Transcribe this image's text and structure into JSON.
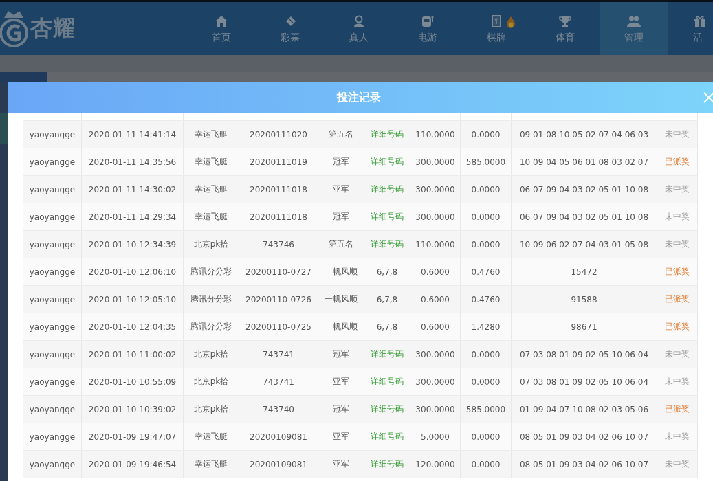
{
  "header": {
    "logo": "杏耀",
    "nav": [
      {
        "label": "首页",
        "kind": "home",
        "selected": false,
        "badge": false
      },
      {
        "label": "彩票",
        "kind": "ticket",
        "selected": false,
        "badge": false
      },
      {
        "label": "真人",
        "kind": "person",
        "selected": false,
        "badge": false
      },
      {
        "label": "电游",
        "kind": "slot",
        "selected": false,
        "badge": false
      },
      {
        "label": "棋牌",
        "kind": "tile",
        "selected": false,
        "badge": true
      },
      {
        "label": "体育",
        "kind": "trophy",
        "selected": false,
        "badge": false
      },
      {
        "label": "管理",
        "kind": "people",
        "selected": true,
        "badge": false
      },
      {
        "label": "活",
        "kind": "gift",
        "selected": false,
        "badge": false
      }
    ]
  },
  "modal": {
    "title": "投注记录",
    "rows": [
      {
        "user": "yaoyangge",
        "time": "2020-01-11 14:41:14",
        "game": "幸运飞艇",
        "issue": "20200111020",
        "play": "第五名",
        "detail": {
          "text": "详细号码",
          "kind": "link"
        },
        "bet": "110.0000",
        "win": "0.0000",
        "numbers": "09 01 08 10 05 02 07 04 06 03",
        "status": {
          "text": "未中奖",
          "kind": "lost"
        }
      },
      {
        "user": "yaoyangge",
        "time": "2020-01-11 14:35:56",
        "game": "幸运飞艇",
        "issue": "20200111019",
        "play": "冠军",
        "detail": {
          "text": "详细号码",
          "kind": "link"
        },
        "bet": "300.0000",
        "win": "585.0000",
        "numbers": "10 09 04 05 06 01 08 03 02 07",
        "status": {
          "text": "已派奖",
          "kind": "paid"
        }
      },
      {
        "user": "yaoyangge",
        "time": "2020-01-11 14:30:02",
        "game": "幸运飞艇",
        "issue": "20200111018",
        "play": "亚军",
        "detail": {
          "text": "详细号码",
          "kind": "link"
        },
        "bet": "300.0000",
        "win": "0.0000",
        "numbers": "06 07 09 04 03 02 05 01 10 08",
        "status": {
          "text": "未中奖",
          "kind": "lost"
        }
      },
      {
        "user": "yaoyangge",
        "time": "2020-01-11 14:29:34",
        "game": "幸运飞艇",
        "issue": "20200111018",
        "play": "冠军",
        "detail": {
          "text": "详细号码",
          "kind": "link"
        },
        "bet": "300.0000",
        "win": "0.0000",
        "numbers": "06 07 09 04 03 02 05 01 10 08",
        "status": {
          "text": "未中奖",
          "kind": "lost"
        }
      },
      {
        "user": "yaoyangge",
        "time": "2020-01-10 12:34:39",
        "game": "北京pk拾",
        "issue": "743746",
        "play": "第五名",
        "detail": {
          "text": "详细号码",
          "kind": "link"
        },
        "bet": "110.0000",
        "win": "0.0000",
        "numbers": "10 09 06 02 07 04 03 01 05 08",
        "status": {
          "text": "未中奖",
          "kind": "lost"
        }
      },
      {
        "user": "yaoyangge",
        "time": "2020-01-10 12:06:10",
        "game": "腾讯分分彩",
        "issue": "20200110-0727",
        "play": "一帆风顺",
        "detail": {
          "text": "6,7,8",
          "kind": "plain"
        },
        "bet": "0.6000",
        "win": "0.4760",
        "numbers": "15472",
        "status": {
          "text": "已派奖",
          "kind": "paid"
        }
      },
      {
        "user": "yaoyangge",
        "time": "2020-01-10 12:05:10",
        "game": "腾讯分分彩",
        "issue": "20200110-0726",
        "play": "一帆风顺",
        "detail": {
          "text": "6,7,8",
          "kind": "plain"
        },
        "bet": "0.6000",
        "win": "0.4760",
        "numbers": "91588",
        "status": {
          "text": "已派奖",
          "kind": "paid"
        }
      },
      {
        "user": "yaoyangge",
        "time": "2020-01-10 12:04:35",
        "game": "腾讯分分彩",
        "issue": "20200110-0725",
        "play": "一帆风顺",
        "detail": {
          "text": "6,7,8",
          "kind": "plain"
        },
        "bet": "0.6000",
        "win": "1.4280",
        "numbers": "98671",
        "status": {
          "text": "已派奖",
          "kind": "paid"
        }
      },
      {
        "user": "yaoyangge",
        "time": "2020-01-10 11:00:02",
        "game": "北京pk拾",
        "issue": "743741",
        "play": "冠军",
        "detail": {
          "text": "详细号码",
          "kind": "link"
        },
        "bet": "300.0000",
        "win": "0.0000",
        "numbers": "07 03 08 01 09 02 05 10 06 04",
        "status": {
          "text": "未中奖",
          "kind": "lost"
        }
      },
      {
        "user": "yaoyangge",
        "time": "2020-01-10 10:55:09",
        "game": "北京pk拾",
        "issue": "743741",
        "play": "亚军",
        "detail": {
          "text": "详细号码",
          "kind": "link"
        },
        "bet": "300.0000",
        "win": "0.0000",
        "numbers": "07 03 08 01 09 02 05 10 06 04",
        "status": {
          "text": "未中奖",
          "kind": "lost"
        }
      },
      {
        "user": "yaoyangge",
        "time": "2020-01-10 10:39:02",
        "game": "北京pk拾",
        "issue": "743740",
        "play": "冠军",
        "detail": {
          "text": "详细号码",
          "kind": "link"
        },
        "bet": "300.0000",
        "win": "585.0000",
        "numbers": "01 09 04 07 10 08 02 03 05 06",
        "status": {
          "text": "已派奖",
          "kind": "paid"
        }
      },
      {
        "user": "yaoyangge",
        "time": "2020-01-09 19:47:07",
        "game": "幸运飞艇",
        "issue": "20200109081",
        "play": "亚军",
        "detail": {
          "text": "详细号码",
          "kind": "link"
        },
        "bet": "5.0000",
        "win": "0.0000",
        "numbers": "08 05 01 09 03 04 02 06 10 07",
        "status": {
          "text": "未中奖",
          "kind": "lost"
        }
      },
      {
        "user": "yaoyangge",
        "time": "2020-01-09 19:46:54",
        "game": "幸运飞艇",
        "issue": "20200109081",
        "play": "亚军",
        "detail": {
          "text": "详细号码",
          "kind": "link"
        },
        "bet": "120.0000",
        "win": "0.0000",
        "numbers": "08 05 01 09 03 04 02 06 10 07",
        "status": {
          "text": "未中奖",
          "kind": "lost"
        }
      }
    ]
  }
}
